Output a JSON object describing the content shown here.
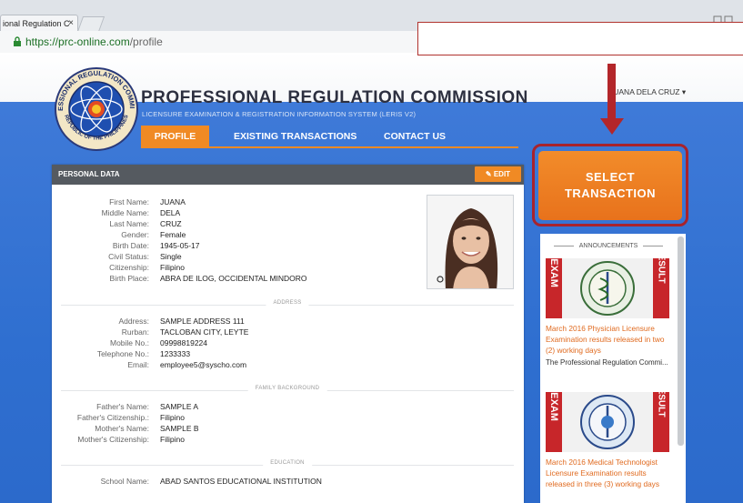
{
  "browser": {
    "tab_title": "ional Regulation C",
    "tab_close": "×",
    "url_host": "https://prc-online.com",
    "url_path": "/profile"
  },
  "header": {
    "title": "PROFESSIONAL REGULATION COMMISSION",
    "subtitle": "LICENSURE EXAMINATION & REGISTRATION INFORMATION SYSTEM (LERIS V2)",
    "user_menu": "JUANA DELA CRUZ ▾",
    "logo_text_top": "PROFESSIONAL REGULATION COMMISSION",
    "logo_text_bottom": "REPUBLIC OF THE PHILIPPINES"
  },
  "nav": {
    "items": [
      {
        "label": "PROFILE",
        "active": true
      },
      {
        "label": "EXISTING TRANSACTIONS",
        "active": false
      },
      {
        "label": "CONTACT US",
        "active": false
      }
    ]
  },
  "panel": {
    "title": "PERSONAL DATA",
    "edit_label": "✎ EDIT"
  },
  "personal": [
    {
      "label": "First Name:",
      "value": "JUANA"
    },
    {
      "label": "Middle Name:",
      "value": "DELA"
    },
    {
      "label": "Last Name:",
      "value": "CRUZ"
    },
    {
      "label": "Gender:",
      "value": "Female"
    },
    {
      "label": "Birth Date:",
      "value": "1945-05-17"
    },
    {
      "label": "Civil Status:",
      "value": "Single"
    },
    {
      "label": "Citizenship:",
      "value": "Filipino"
    },
    {
      "label": "Birth Place:",
      "value": "ABRA DE ILOG, OCCIDENTAL MINDORO"
    }
  ],
  "sections": {
    "address": "ADDRESS",
    "family": "FAMILY BACKGROUND",
    "education": "EDUCATION"
  },
  "address": [
    {
      "label": "Address:",
      "value": "SAMPLE ADDRESS 111"
    },
    {
      "label": "Rurban:",
      "value": "TACLOBAN CITY, LEYTE"
    },
    {
      "label": "Mobile No.:",
      "value": "09998819224"
    },
    {
      "label": "Telephone No.:",
      "value": "1233333"
    },
    {
      "label": "Email:",
      "value": "employee5@syscho.com"
    }
  ],
  "family": [
    {
      "label": "Father's Name:",
      "value": "SAMPLE A"
    },
    {
      "label": "Father's Citizenship.:",
      "value": "Filipino"
    },
    {
      "label": "Mother's Name:",
      "value": "SAMPLE B"
    },
    {
      "label": "Mother's Citizenship:",
      "value": "Filipino"
    }
  ],
  "education": [
    {
      "label": "School Name:",
      "value": "ABAD SANTOS EDUCATIONAL INSTITUTION"
    }
  ],
  "actions": {
    "select_transaction": "SELECT TRANSACTION"
  },
  "announcements": {
    "heading": "ANNOUNCEMENTS",
    "items": [
      {
        "image_left": "EXAM",
        "image_right": "RESULT",
        "title": "March 2016 Physician Licensure Examination results released in two (2) working days",
        "desc": "The Professional Regulation Commi..."
      },
      {
        "image_left": "EXAM",
        "image_right": "RESULT",
        "title": "March 2016 Medical Technologist Licensure Examination results released in three (3) working days",
        "desc": ""
      }
    ]
  },
  "colors": {
    "accent_orange": "#f08a24",
    "header_blue": "#3f7ad8",
    "highlight_red": "#a8232c",
    "panel_head": "#555a60"
  }
}
